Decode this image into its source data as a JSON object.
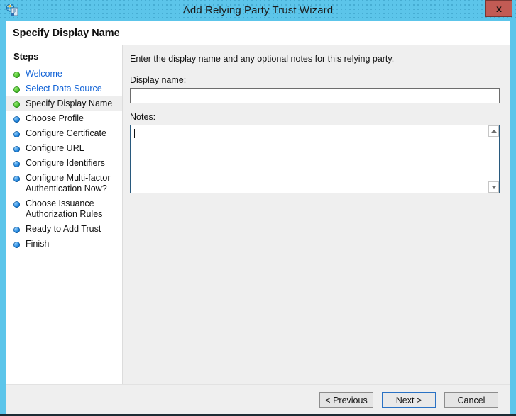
{
  "window": {
    "title": "Add Relying Party Trust Wizard",
    "icon": "relying-party-trust-icon",
    "close_label": "x",
    "accent_color": "#5cc5ea"
  },
  "header": {
    "title": "Specify Display Name"
  },
  "sidebar": {
    "heading": "Steps",
    "items": [
      {
        "label": "Welcome",
        "state": "done",
        "link": true,
        "current": false
      },
      {
        "label": "Select Data Source",
        "state": "done",
        "link": true,
        "current": false
      },
      {
        "label": "Specify Display Name",
        "state": "done",
        "link": false,
        "current": true
      },
      {
        "label": "Choose Profile",
        "state": "todo",
        "link": false,
        "current": false
      },
      {
        "label": "Configure Certificate",
        "state": "todo",
        "link": false,
        "current": false
      },
      {
        "label": "Configure URL",
        "state": "todo",
        "link": false,
        "current": false
      },
      {
        "label": "Configure Identifiers",
        "state": "todo",
        "link": false,
        "current": false
      },
      {
        "label": "Configure Multi-factor Authentication Now?",
        "state": "todo",
        "link": false,
        "current": false
      },
      {
        "label": "Choose Issuance Authorization Rules",
        "state": "todo",
        "link": false,
        "current": false
      },
      {
        "label": "Ready to Add Trust",
        "state": "todo",
        "link": false,
        "current": false
      },
      {
        "label": "Finish",
        "state": "todo",
        "link": false,
        "current": false
      }
    ],
    "colors": {
      "done": "#49c02a",
      "todo": "#1f86e0",
      "link": "#1062d6"
    }
  },
  "content": {
    "intro": "Enter the display name and any optional notes for this relying party.",
    "display_name": {
      "label": "Display name:",
      "value": "",
      "placeholder": ""
    },
    "notes": {
      "label": "Notes:",
      "value": "",
      "placeholder": "",
      "focused": true
    }
  },
  "footer": {
    "previous_label": "< Previous",
    "next_label": "Next >",
    "cancel_label": "Cancel",
    "default_button": "Next >"
  }
}
